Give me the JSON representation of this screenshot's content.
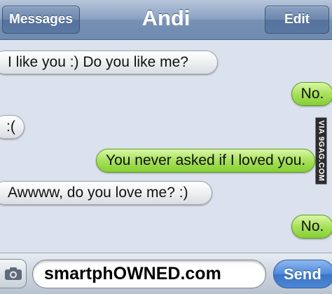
{
  "navbar": {
    "back_label": "Messages",
    "title": "Andi",
    "edit_label": "Edit"
  },
  "messages": [
    {
      "from": "them",
      "text": "I like you :)  Do you like me?"
    },
    {
      "from": "me",
      "text": "No."
    },
    {
      "from": "them",
      "text": ":("
    },
    {
      "from": "me",
      "text": "You never asked if I loved you."
    },
    {
      "from": "them",
      "text": "Awwww, do you love me? :)"
    },
    {
      "from": "me",
      "text": "No."
    }
  ],
  "watermark": "VIA 9GAG.COM",
  "input_bar": {
    "camera_icon": "camera-icon",
    "field_text": "smartphOWNED.com",
    "send_label": "Send"
  }
}
